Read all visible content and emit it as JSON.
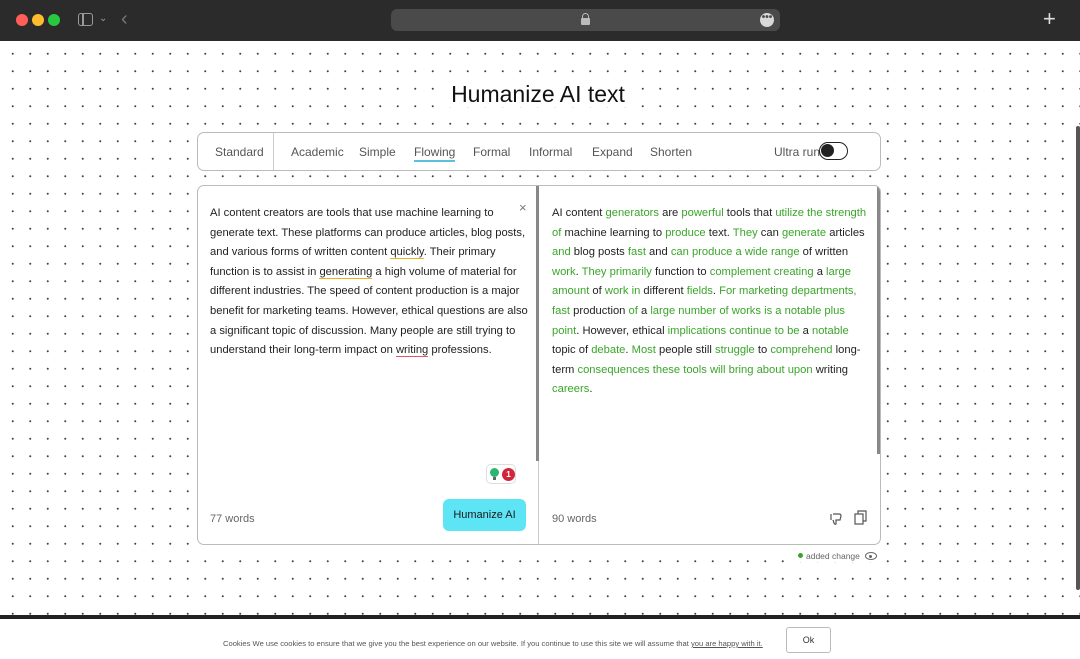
{
  "browser": {
    "icons": [
      "close-dot",
      "minimize-dot",
      "zoom-dot",
      "sidebar-icon",
      "chevron-down-icon",
      "back-icon",
      "lock-icon",
      "more-icon",
      "new-tab-icon"
    ],
    "new_tab_glyph": "+",
    "back_glyph": "‹",
    "chevron_glyph": "⌄",
    "more_glyph": "•••"
  },
  "page": {
    "title": "Humanize AI text"
  },
  "modes": {
    "items": [
      {
        "label": "Standard"
      },
      {
        "label": "Academic"
      },
      {
        "label": "Simple"
      },
      {
        "label": "Flowing",
        "active": true
      },
      {
        "label": "Formal"
      },
      {
        "label": "Informal"
      },
      {
        "label": "Expand"
      },
      {
        "label": "Shorten"
      }
    ],
    "ultra_label": "Ultra run",
    "ultra_on": false
  },
  "input": {
    "segments": [
      {
        "t": "AI content creators are tools that use machine learning to generate text. These platforms can produce articles, blog posts, and various forms of written content "
      },
      {
        "t": "quickly",
        "u": "yellow"
      },
      {
        "t": ". Their primary function is to assist in "
      },
      {
        "t": "generating",
        "u": "yellow"
      },
      {
        "t": " a high volume of material for different industries. The speed of content production is a major benefit for marketing teams. However, ethical questions are also a significant topic of discussion. Many people are still trying to understand their long-term impact on "
      },
      {
        "t": "writing",
        "u": "red"
      },
      {
        "t": " professions."
      }
    ],
    "close_glyph": "×",
    "suggestion_count": "1",
    "word_count": "77 words",
    "button_label": "Humanize AI"
  },
  "output": {
    "segments": [
      {
        "t": "AI content "
      },
      {
        "t": "generators",
        "c": true
      },
      {
        "t": " are "
      },
      {
        "t": "powerful",
        "c": true
      },
      {
        "t": " tools that "
      },
      {
        "t": "utilize the strength of",
        "c": true
      },
      {
        "t": " machine learning to "
      },
      {
        "t": "produce",
        "c": true
      },
      {
        "t": " text. "
      },
      {
        "t": "They",
        "c": true
      },
      {
        "t": " can "
      },
      {
        "t": "generate",
        "c": true
      },
      {
        "t": " articles "
      },
      {
        "t": "and",
        "c": true
      },
      {
        "t": " blog posts "
      },
      {
        "t": "fast",
        "c": true
      },
      {
        "t": " and "
      },
      {
        "t": "can produce a wide range",
        "c": true
      },
      {
        "t": " of written "
      },
      {
        "t": "work",
        "c": true
      },
      {
        "t": ". "
      },
      {
        "t": "They primarily",
        "c": true
      },
      {
        "t": " function to "
      },
      {
        "t": "complement creating",
        "c": true
      },
      {
        "t": " a "
      },
      {
        "t": "large amount",
        "c": true
      },
      {
        "t": " of "
      },
      {
        "t": "work in",
        "c": true
      },
      {
        "t": " different "
      },
      {
        "t": "fields",
        "c": true
      },
      {
        "t": ". "
      },
      {
        "t": "For marketing departments, fast",
        "c": true
      },
      {
        "t": " production "
      },
      {
        "t": "of",
        "c": true
      },
      {
        "t": " a "
      },
      {
        "t": "large number of works is a notable plus point",
        "c": true
      },
      {
        "t": ". However, ethical "
      },
      {
        "t": "implications continue to be",
        "c": true
      },
      {
        "t": " a "
      },
      {
        "t": "notable",
        "c": true
      },
      {
        "t": " topic of "
      },
      {
        "t": "debate",
        "c": true
      },
      {
        "t": ". "
      },
      {
        "t": "Most",
        "c": true
      },
      {
        "t": " people still "
      },
      {
        "t": "struggle",
        "c": true
      },
      {
        "t": " to "
      },
      {
        "t": "comprehend",
        "c": true
      },
      {
        "t": " long-term "
      },
      {
        "t": "consequences these tools will bring about upon",
        "c": true
      },
      {
        "t": " writing "
      },
      {
        "t": "careers",
        "c": true
      },
      {
        "t": "."
      }
    ],
    "word_count": "90 words"
  },
  "legend": {
    "label": "added change"
  },
  "cookie": {
    "prefix": "Cookies   We use cookies to ensure that we give you the best experience on our website. If you continue to use this site we will assume that ",
    "link": "you are happy with it.",
    "button": "Ok"
  },
  "colors": {
    "accent_cyan": "#5ee5f5",
    "change_green": "#3aa52a",
    "badge_red": "#d0263b"
  }
}
